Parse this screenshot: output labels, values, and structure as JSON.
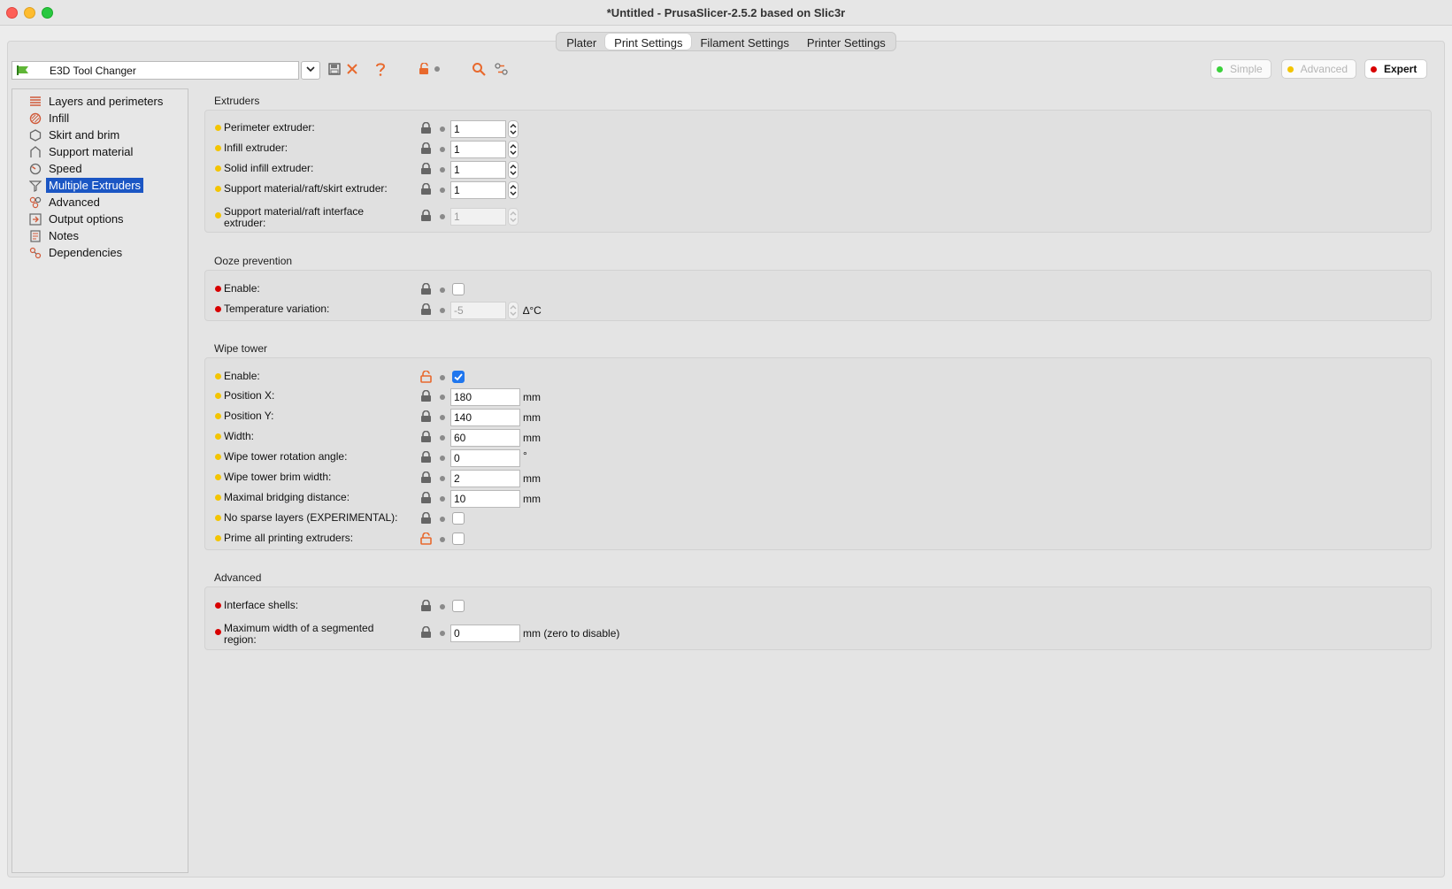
{
  "window": {
    "title": "*Untitled - PrusaSlicer-2.5.2 based on Slic3r"
  },
  "tabs": [
    {
      "label": "Plater"
    },
    {
      "label": "Print Settings"
    },
    {
      "label": "Filament Settings"
    },
    {
      "label": "Printer Settings"
    }
  ],
  "toolbar": {
    "preset": "E3D Tool Changer",
    "modes": {
      "simple": "Simple",
      "advanced": "Advanced",
      "expert": "Expert"
    }
  },
  "colors": {
    "accent": "#1b56c4",
    "orange_icon": "#e8692d",
    "yellow_mark": "#f3c400",
    "red_mark": "#d80000",
    "simple_dot": "#3bd13b",
    "advanced_dot": "#f3c400",
    "expert_dot": "#d80000"
  },
  "sidebar": {
    "items": [
      {
        "label": "Layers and perimeters",
        "icon": "layers-icon"
      },
      {
        "label": "Infill",
        "icon": "infill-icon"
      },
      {
        "label": "Skirt and brim",
        "icon": "skirt-icon"
      },
      {
        "label": "Support material",
        "icon": "support-icon"
      },
      {
        "label": "Speed",
        "icon": "speed-icon"
      },
      {
        "label": "Multiple Extruders",
        "icon": "funnel-icon"
      },
      {
        "label": "Advanced",
        "icon": "advanced-icon"
      },
      {
        "label": "Output options",
        "icon": "output-icon"
      },
      {
        "label": "Notes",
        "icon": "notes-icon"
      },
      {
        "label": "Dependencies",
        "icon": "dependencies-icon"
      }
    ],
    "selected": "Multiple Extruders"
  },
  "groups": {
    "extruders": {
      "title": "Extruders",
      "perimeter": {
        "label": "Perimeter extruder:",
        "value": "1"
      },
      "infill": {
        "label": "Infill extruder:",
        "value": "1"
      },
      "solid_infill": {
        "label": "Solid infill extruder:",
        "value": "1"
      },
      "support": {
        "label": "Support material/raft/skirt extruder:",
        "value": "1"
      },
      "support_interface": {
        "label": "Support material/raft interface extruder:",
        "value": "1"
      }
    },
    "ooze": {
      "title": "Ooze prevention",
      "enable": {
        "label": "Enable:",
        "checked": false
      },
      "temp_variation": {
        "label": "Temperature variation:",
        "value": "-5",
        "unit": "∆°C"
      }
    },
    "wipe_tower": {
      "title": "Wipe tower",
      "enable": {
        "label": "Enable:",
        "checked": true
      },
      "pos_x": {
        "label": "Position X:",
        "value": "180",
        "unit": "mm"
      },
      "pos_y": {
        "label": "Position Y:",
        "value": "140",
        "unit": "mm"
      },
      "width": {
        "label": "Width:",
        "value": "60",
        "unit": "mm"
      },
      "rotation": {
        "label": "Wipe tower rotation angle:",
        "value": "0",
        "unit": "°"
      },
      "brim": {
        "label": "Wipe tower brim width:",
        "value": "2",
        "unit": "mm"
      },
      "bridging": {
        "label": "Maximal bridging distance:",
        "value": "10",
        "unit": "mm"
      },
      "no_sparse": {
        "label": "No sparse layers (EXPERIMENTAL):",
        "checked": false
      },
      "prime_all": {
        "label": "Prime all printing extruders:",
        "checked": false
      }
    },
    "advanced": {
      "title": "Advanced",
      "interface_shells": {
        "label": "Interface shells:",
        "checked": false
      },
      "max_seg_width": {
        "label": "Maximum width of a segmented region:",
        "value": "0",
        "unit": "mm (zero to disable)"
      }
    }
  }
}
